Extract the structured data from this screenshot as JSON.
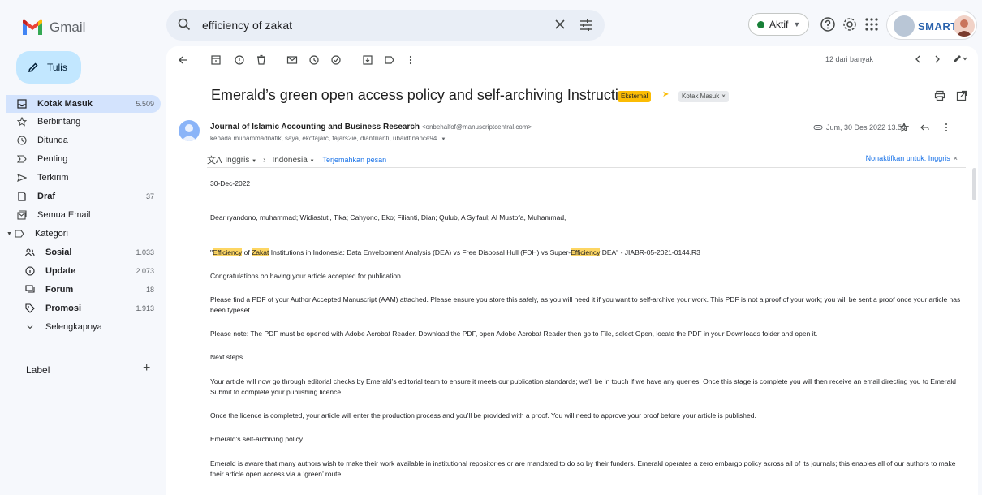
{
  "app": {
    "name": "Gmail"
  },
  "search": {
    "value": "efficiency of zakat"
  },
  "header": {
    "status_label": "Aktif",
    "account_label": "SMART"
  },
  "sidebar": {
    "compose_label": "Tulis",
    "items": [
      {
        "label": "Kotak Masuk",
        "count": "5.509",
        "icon": "inbox-icon"
      },
      {
        "label": "Berbintang",
        "count": "",
        "icon": "star-icon"
      },
      {
        "label": "Ditunda",
        "count": "",
        "icon": "clock-icon"
      },
      {
        "label": "Penting",
        "count": "",
        "icon": "important-icon"
      },
      {
        "label": "Terkirim",
        "count": "",
        "icon": "send-icon"
      },
      {
        "label": "Draf",
        "count": "37",
        "icon": "draft-icon"
      },
      {
        "label": "Semua Email",
        "count": "",
        "icon": "all-mail-icon"
      },
      {
        "label": "Kategori",
        "count": "",
        "icon": "category-icon"
      },
      {
        "label": "Sosial",
        "count": "1.033",
        "icon": "people-icon"
      },
      {
        "label": "Update",
        "count": "2.073",
        "icon": "info-icon"
      },
      {
        "label": "Forum",
        "count": "18",
        "icon": "forum-icon"
      },
      {
        "label": "Promosi",
        "count": "1.913",
        "icon": "tag-icon"
      },
      {
        "label": "Selengkapnya",
        "count": "",
        "icon": "chevron-down-icon"
      }
    ],
    "labels_heading": "Label"
  },
  "toolbar": {
    "pager": "12 dari banyak"
  },
  "email": {
    "subject": "Emerald’s green open access policy and self-archiving Instructions",
    "tags": {
      "external": "Eksternal",
      "inbox": "Kotak Masuk"
    },
    "sender_name": "Journal of Islamic Accounting and Business Research",
    "sender_email": "<onbehalfof@manuscriptcentral.com>",
    "recipients": "kepada muhammadnafik, saya, ekofajarc, fajars2ie, dianfilianti, ubaidfinance94",
    "date": "Jum, 30 Des 2022 13.54",
    "translate": {
      "from": "Inggris",
      "to": "Indonesia",
      "translate_link": "Terjemahkan pesan",
      "disable": "Nonaktifkan untuk: Inggris"
    },
    "body": {
      "date_line": "30-Dec-2022",
      "greeting": "Dear ryandono, muhammad; Widiastuti, Tika; Cahyono, Eko; Filianti, Dian; Qulub, A Syifaul; Al Mustofa, Muhammad,",
      "title_q_open": "\"",
      "title_hl1": "Efficiency",
      "title_of": " of ",
      "title_hl2": "Zakat",
      "title_mid": " Institutions in Indonesia: Data Envelopment Analysis (DEA) vs Free Disposal Hull (FDH) vs Super-",
      "title_hl3": "Efficiency",
      "title_end": " DEA\" - JIABR-05-2021-0144.R3",
      "congrats": "Congratulations on having your article accepted for publication.",
      "pdf_para": "Please find a PDF of your Author Accepted Manuscript (AAM) attached. Please ensure you store this safely, as you will need it if you want to self-archive your work. This PDF is not a proof of your work; you will be sent a proof once your article has been typeset.",
      "note_para": "Please note: The PDF must be opened with Adobe Acrobat Reader. Download the PDF, open Adobe Acrobat Reader then go to File, select Open, locate the PDF in your Downloads folder and open it.",
      "next_steps": "Next steps",
      "editorial_para": "Your article will now go through editorial checks by Emerald’s editorial team to ensure it meets our publication standards; we’ll be in touch if we have any queries. Once this stage is complete you will then receive an email directing you to Emerald Submit to complete your publishing licence.",
      "licence_para": "Once the licence is completed, your article will enter the production process and you’ll be provided with a proof. You will need to approve your proof before your article is published.",
      "policy_head": "Emerald's self-archiving policy",
      "policy_para": "Emerald is aware that many authors wish to make their work available in institutional repositories or are mandated to do so by their funders. Emerald operates a zero embargo policy across all of its journals; this enables all of our authors to make their article open access via a ‘green’ route."
    }
  },
  "colors": {
    "accent": "#1a73e8",
    "compose": "#c2e7ff",
    "highlight": "#fdd663",
    "external_tag": "#fbbc04"
  }
}
